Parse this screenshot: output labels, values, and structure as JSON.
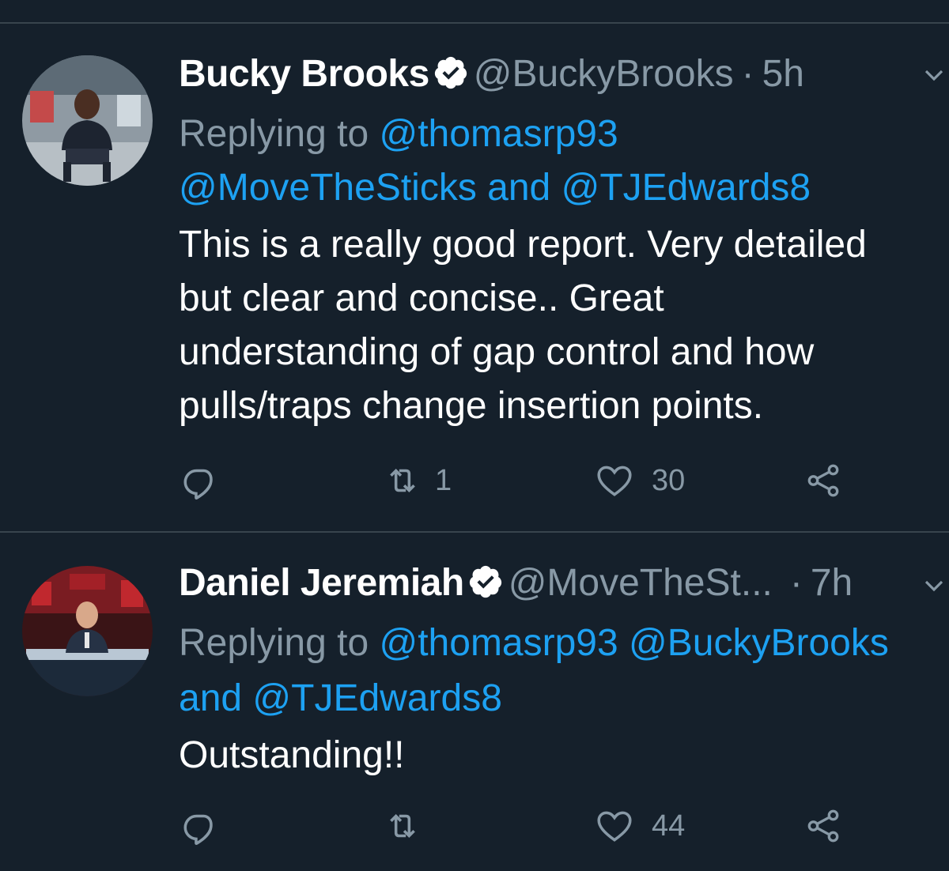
{
  "colors": {
    "background": "#15202b",
    "divider": "#38444d",
    "text": "#ffffff",
    "secondary": "#8899a6",
    "link": "#1da1f2",
    "verified_badge": "#ffffff"
  },
  "tweets": [
    {
      "name": "Bucky Brooks",
      "verified": true,
      "handle": "@BuckyBrooks",
      "separator": "·",
      "time": "5h",
      "replying_prefix": "Replying to",
      "mention_line1": "@thomasrp93",
      "mention_line2": "@MoveTheSticks and @TJEdwards8",
      "text_lines": [
        "This is a really good report. Very detailed",
        "but clear and concise.. Great",
        "understanding of gap control and how",
        "pulls/traps change insertion points."
      ],
      "actions": {
        "reply_icon": "reply-icon",
        "retweet_icon": "retweet-icon",
        "retweet_count": "1",
        "like_icon": "heart-icon",
        "like_count": "30",
        "share_icon": "share-icon"
      }
    },
    {
      "name": "Daniel Jeremiah",
      "verified": true,
      "handle": "@MoveTheSt...",
      "separator": "·",
      "time": "7h",
      "replying_prefix": "Replying to",
      "mention_line1": "@thomasrp93 @BuckyBrooks",
      "mention_line2": "and @TJEdwards8",
      "text_lines": [
        "Outstanding!!"
      ],
      "actions": {
        "reply_icon": "reply-icon",
        "retweet_icon": "retweet-icon",
        "retweet_count": "",
        "like_icon": "heart-icon",
        "like_count": "44",
        "share_icon": "share-icon"
      }
    }
  ]
}
